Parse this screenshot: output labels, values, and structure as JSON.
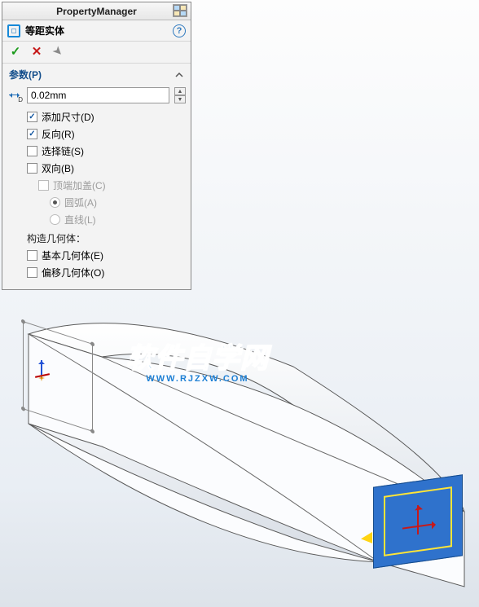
{
  "panel": {
    "title": "PropertyManager",
    "feature_name": "等距实体",
    "actions": {
      "ok": "✓",
      "cancel": "✕",
      "pin": "📌"
    }
  },
  "section": {
    "header": "参数(P)",
    "distance_value": "0.02mm"
  },
  "options": {
    "add_dim": {
      "label": "添加尺寸(D)",
      "checked": true,
      "enabled": true
    },
    "reverse": {
      "label": "反向(R)",
      "checked": true,
      "enabled": true
    },
    "select_chain": {
      "label": "选择链(S)",
      "checked": false,
      "enabled": true
    },
    "bi_dir": {
      "label": "双向(B)",
      "checked": false,
      "enabled": true
    },
    "cap_ends": {
      "label": "顶端加盖(C)",
      "checked": false,
      "enabled": false
    },
    "arc": {
      "label": "圆弧(A)",
      "selected": true,
      "enabled": false
    },
    "line": {
      "label": "直线(L)",
      "selected": false,
      "enabled": false
    },
    "construct_label": "构造几何体：",
    "base_geom": {
      "label": "基本几何体(E)",
      "checked": false,
      "enabled": true
    },
    "offset_geom": {
      "label": "偏移几何体(O)",
      "checked": false,
      "enabled": true
    }
  },
  "watermark": {
    "big": "软件自学网",
    "small": "WWW.RJZXW.COM"
  }
}
